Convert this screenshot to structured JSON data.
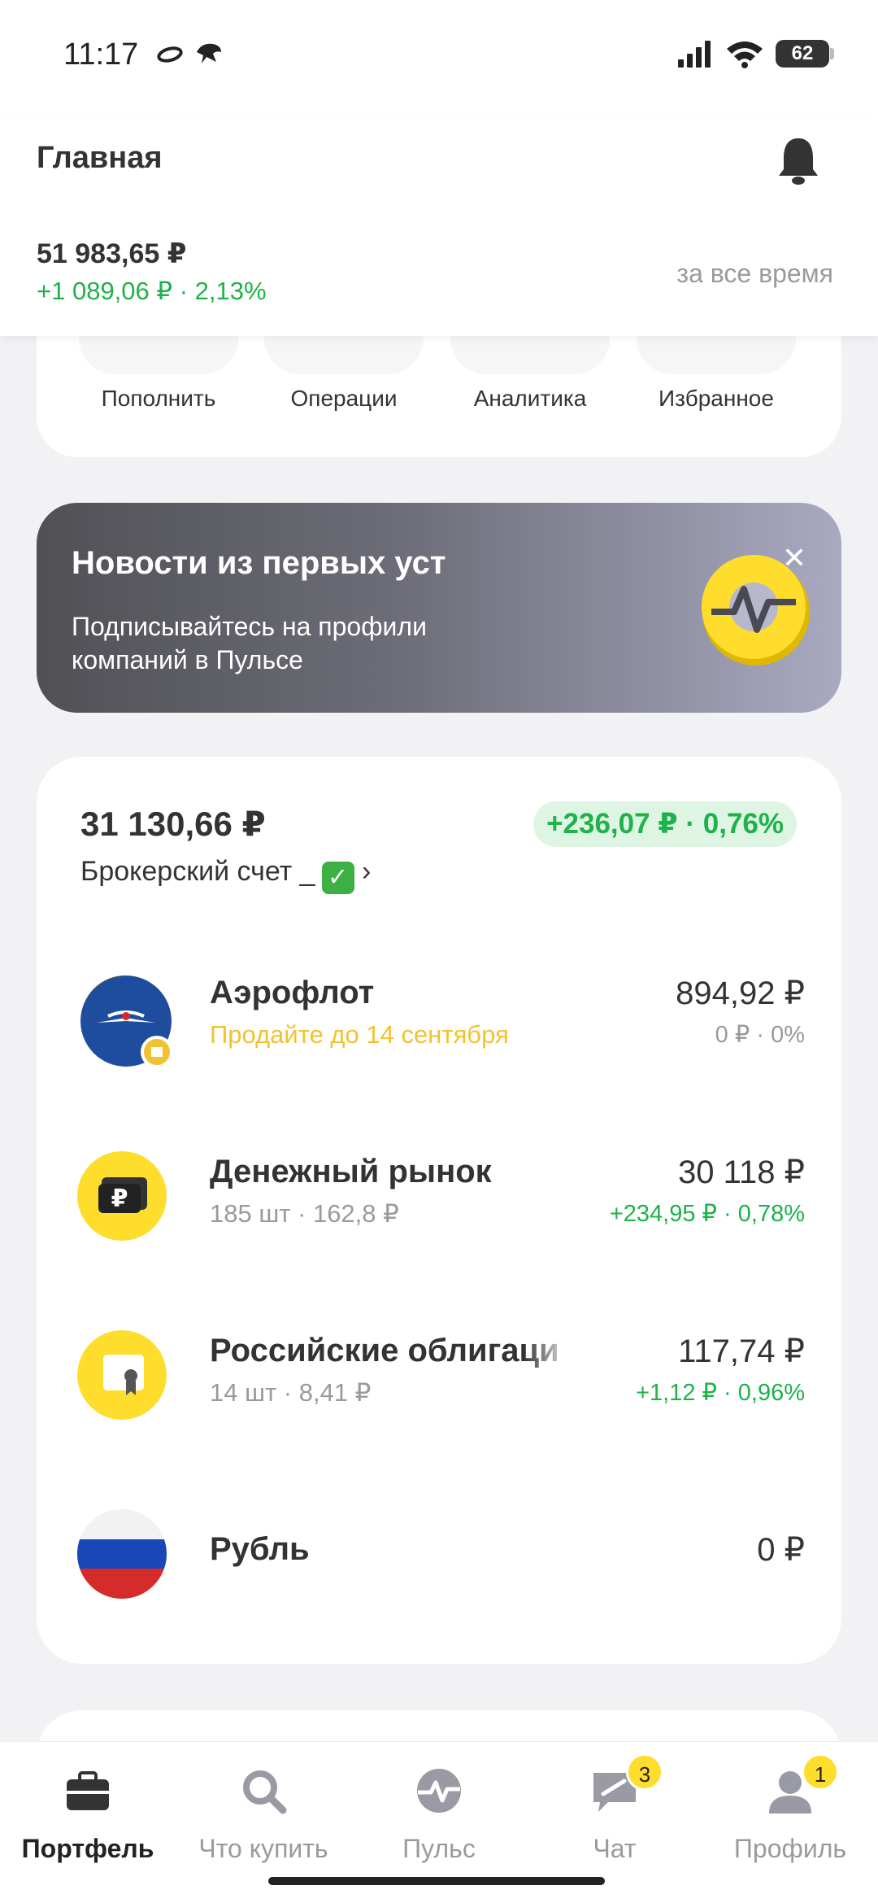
{
  "status_bar": {
    "time": "11:17",
    "battery": "62"
  },
  "header": {
    "title": "Главная",
    "total_value": "51 983,65 ₽",
    "total_change": "+1 089,06 ₽ · 2,13%",
    "period": "за все время"
  },
  "quick_actions": [
    {
      "label": "Пополнить",
      "icon": "top-up-icon"
    },
    {
      "label": "Операции",
      "icon": "operations-icon"
    },
    {
      "label": "Аналитика",
      "icon": "analytics-icon"
    },
    {
      "label": "Избранное",
      "icon": "star-icon"
    }
  ],
  "banner": {
    "title": "Новости из первых уст",
    "text": "Подписывайтесь на профили компаний в Пульсе",
    "close": "✕"
  },
  "account": {
    "total": "31 130,66 ₽",
    "change": "+236,07 ₽ · 0,76%",
    "name": "Брокерский счет _",
    "check": "✓",
    "chevron": "›"
  },
  "assets": [
    {
      "name": "Аэрофлот",
      "sub": "Продайте до 14 сентября",
      "value": "894,92 ₽",
      "change": "0 ₽ · 0%",
      "icon": "aeroflot-logo-icon"
    },
    {
      "name": "Денежный рынок",
      "sub": "185 шт · 162,8 ₽",
      "value": "30 118 ₽",
      "change": "+234,95 ₽ · 0,78%",
      "icon": "money-market-icon"
    },
    {
      "name": "Российские облигаци",
      "sub": "14 шт · 8,41 ₽",
      "value": "117,74 ₽",
      "change": "+1,12 ₽ · 0,96%",
      "icon": "bonds-icon"
    },
    {
      "name": "Рубль",
      "sub": "",
      "value": "0 ₽",
      "change": "",
      "icon": "russia-flag-icon"
    }
  ],
  "nav": [
    {
      "label": "Портфель",
      "icon": "briefcase-icon",
      "active": true
    },
    {
      "label": "Что купить",
      "icon": "search-icon"
    },
    {
      "label": "Пульс",
      "icon": "pulse-icon"
    },
    {
      "label": "Чат",
      "icon": "chat-icon",
      "badge": "3"
    },
    {
      "label": "Профиль",
      "icon": "profile-icon",
      "badge": "1"
    }
  ],
  "colors": {
    "accent_yellow": "#ffdd2d",
    "positive": "#1eb24b",
    "muted": "#9a9a9a"
  }
}
